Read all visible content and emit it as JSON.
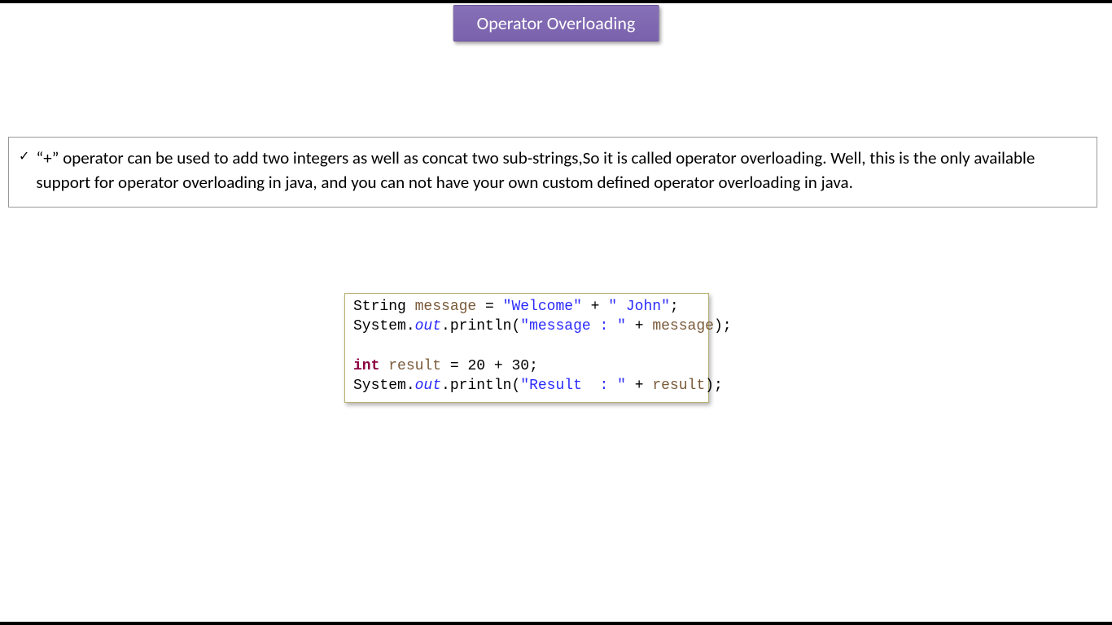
{
  "title": "Operator Overloading",
  "description": "“+” operator can be used to add two integers as well as concat two sub-strings,So it is called operator overloading. Well, this is the only available support for operator overloading in java, and you can not have your own custom defined operator overloading in java.",
  "code": {
    "line1": {
      "type": "String",
      "var": "message",
      "eq": " = ",
      "str1": "\"Welcome\"",
      "plus": " + ",
      "str2": "\" John\"",
      "semi": ";"
    },
    "line2": {
      "obj": "System",
      "dot1": ".",
      "field": "out",
      "dot2": ".",
      "method": "println",
      "lparen": "(",
      "str": "\"message : \"",
      "plus": " + ",
      "var": "message",
      "rparen": ")",
      "semi": ";"
    },
    "line3": {
      "kw": "int",
      "sp": " ",
      "var": "result",
      "eq": " = ",
      "n1": "20",
      "plus": " + ",
      "n2": "30",
      "semi": ";"
    },
    "line4": {
      "obj": "System",
      "dot1": ".",
      "field": "out",
      "dot2": ".",
      "method": "println",
      "lparen": "(",
      "str": "\"Result  : \"",
      "plus": " + ",
      "var": "result",
      "rparen": ")",
      "semi": ";"
    }
  }
}
